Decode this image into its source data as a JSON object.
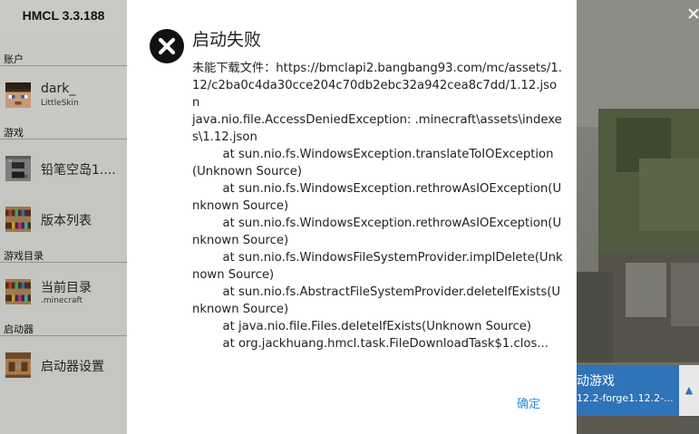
{
  "app": {
    "title": "HMCL 3.3.188"
  },
  "window": {
    "close_glyph": "✕"
  },
  "sidebar": {
    "account": {
      "label": "账户",
      "user_name": "dark_",
      "user_sub": "LittleSkin",
      "icon": "player-head-icon"
    },
    "game": {
      "label": "游戏",
      "items": [
        {
          "label": "铅笔空岛1....",
          "icon": "furnace-icon"
        },
        {
          "label": "版本列表",
          "icon": "bookshelf-icon"
        }
      ]
    },
    "game_dir": {
      "label": "游戏目录",
      "item_label": "当前目录",
      "item_sub": ".minecraft",
      "icon": "bookshelf-icon"
    },
    "launcher": {
      "label": "启动器",
      "item_label": "启动器设置",
      "icon": "crafting-table-icon"
    }
  },
  "launch": {
    "title": "动游戏",
    "subtitle": "12.2-forge1.12.2-...",
    "arrow": "▲",
    "icon": "expand-icon"
  },
  "dialog": {
    "title": "启动失败",
    "icon": "error-x-icon",
    "message": "未能下载文件：https://bmclapi2.bangbang93.com/mc/assets/1.12/c2ba0c4da30cce204c70db2ebc32a942cea8c7dd/1.12.json\njava.nio.file.AccessDeniedException: .minecraft\\assets\\indexes\\1.12.json\n        at sun.nio.fs.WindowsException.translateToIOException(Unknown Source)\n        at sun.nio.fs.WindowsException.rethrowAsIOException(Unknown Source)\n        at sun.nio.fs.WindowsException.rethrowAsIOException(Unknown Source)\n        at sun.nio.fs.WindowsFileSystemProvider.implDelete(Unknown Source)\n        at sun.nio.fs.AbstractFileSystemProvider.deleteIfExists(Unknown Source)\n        at java.nio.file.Files.deleteIfExists(Unknown Source)\n        at org.jackhuang.hmcl.task.FileDownloadTask$1.clos...",
    "ok_label": "确定"
  },
  "colors": {
    "accent": "#2f73b9",
    "link": "#2a8fd8",
    "error": "#111111"
  }
}
